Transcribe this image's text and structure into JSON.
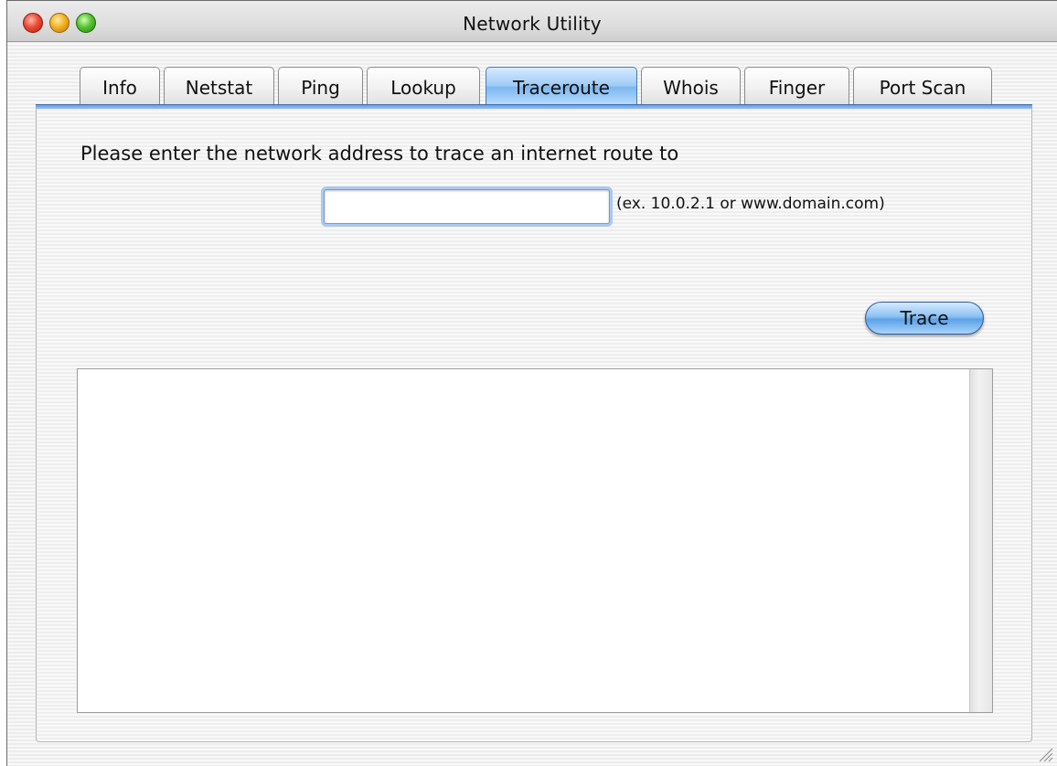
{
  "window": {
    "title": "Network Utility"
  },
  "tabs": [
    {
      "label": "Info"
    },
    {
      "label": "Netstat"
    },
    {
      "label": "Ping"
    },
    {
      "label": "Lookup"
    },
    {
      "label": "Traceroute",
      "active": true
    },
    {
      "label": "Whois"
    },
    {
      "label": "Finger"
    },
    {
      "label": "Port Scan"
    }
  ],
  "traceroute": {
    "prompt": "Please enter the network address to trace an internet route to",
    "address_value": "",
    "hint": "(ex. 10.0.2.1 or www.domain.com)",
    "trace_label": "Trace",
    "output": ""
  },
  "colors": {
    "accent": "#7bb6f0",
    "close": "#ec4a37",
    "minimize": "#f3b21f",
    "zoom": "#56c432"
  }
}
